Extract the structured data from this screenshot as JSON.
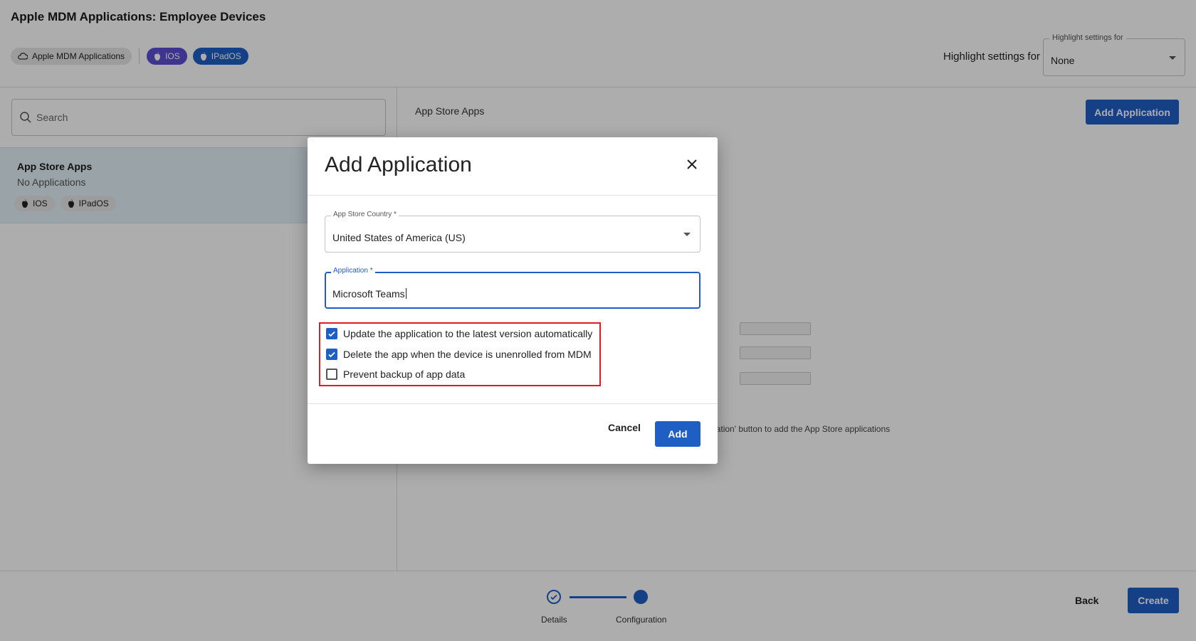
{
  "page": {
    "title": "Apple MDM Applications: Employee Devices",
    "tags": [
      "Apple MDM Applications",
      "IOS",
      "IPadOS"
    ],
    "highlight_label": "Highlight settings for",
    "highlight_select": {
      "legend": "Highlight settings for",
      "value": "None"
    }
  },
  "left_pane": {
    "search_placeholder": "Search",
    "items": [
      {
        "name": "App Store Apps",
        "subtitle": "No Applications",
        "tags": [
          "IOS",
          "IPadOS"
        ]
      }
    ]
  },
  "right_pane": {
    "title": "App Store Apps",
    "add_button": "Add Application",
    "empty_text": "Application' button to add the App Store applications"
  },
  "footer": {
    "steps": [
      "Details",
      "Configuration"
    ],
    "back": "Back",
    "create": "Create"
  },
  "modal": {
    "title": "Add Application",
    "country_field": {
      "legend": "App Store Country *",
      "value": "United States of America (US)"
    },
    "application_field": {
      "legend": "Application *",
      "value": "Microsoft Teams"
    },
    "checkboxes": [
      {
        "label": "Update the application to the latest version automatically",
        "checked": true
      },
      {
        "label": "Delete the app when the device is unenrolled from MDM",
        "checked": true
      },
      {
        "label": "Prevent backup of app data",
        "checked": false
      }
    ],
    "cancel": "Cancel",
    "add": "Add"
  },
  "colors": {
    "primary": "#1f5fc4",
    "purple_chip": "#5b4ed1",
    "highlight_border": "#e01b24",
    "selected_item_bg": "#e4f1f8"
  }
}
